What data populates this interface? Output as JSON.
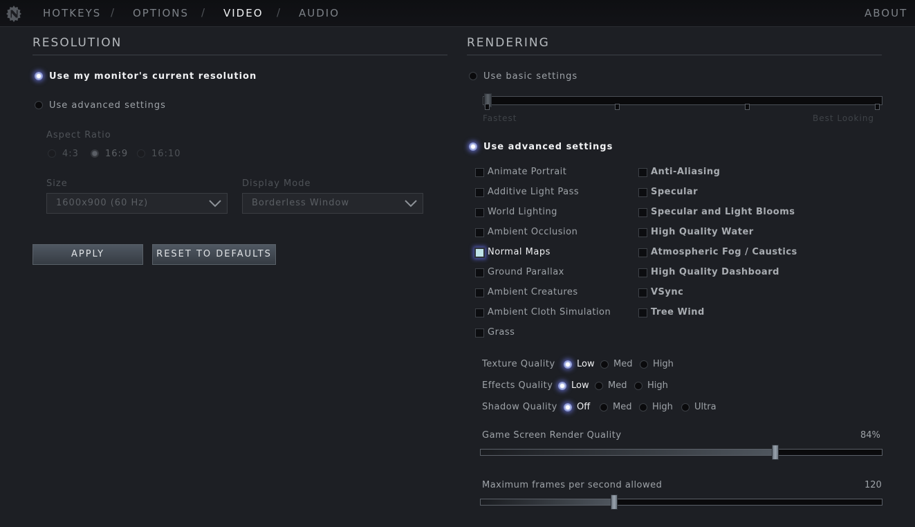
{
  "nav": {
    "hotkeys": "HOTKEYS",
    "options": "OPTIONS",
    "video": "VIDEO",
    "audio": "AUDIO",
    "about": "ABOUT",
    "separator": "/"
  },
  "resolution": {
    "title": "RESOLUTION",
    "use_current": "Use my monitor's current resolution",
    "use_advanced": "Use advanced settings",
    "selected_mode": "Use my monitor's current resolution",
    "aspect_ratio": {
      "label": "Aspect Ratio",
      "options": [
        "4:3",
        "16:9",
        "16:10"
      ],
      "selected": "16:9"
    },
    "size": {
      "label": "Size",
      "value": "1600x900 (60 Hz)"
    },
    "display_mode": {
      "label": "Display Mode",
      "value": "Borderless Window"
    },
    "apply_button": "APPLY",
    "reset_button": "RESET TO DEFAULTS"
  },
  "rendering": {
    "title": "RENDERING",
    "use_basic": "Use basic settings",
    "use_advanced": "Use advanced settings",
    "selected_mode": "Use advanced settings",
    "basic_slider": {
      "min_label": "Fastest",
      "max_label": "Best Looking",
      "stops": 4,
      "value": 0
    },
    "checkboxes_left": [
      {
        "label": "Animate Portrait",
        "checked": false
      },
      {
        "label": "Additive Light Pass",
        "checked": false
      },
      {
        "label": "World Lighting",
        "checked": false
      },
      {
        "label": "Ambient Occlusion",
        "checked": false
      },
      {
        "label": "Normal Maps",
        "checked": true
      },
      {
        "label": "Ground Parallax",
        "checked": false
      },
      {
        "label": "Ambient Creatures",
        "checked": false
      },
      {
        "label": "Ambient Cloth Simulation",
        "checked": false
      },
      {
        "label": "Grass",
        "checked": false
      }
    ],
    "checkboxes_right": [
      {
        "label": "Anti-Aliasing",
        "checked": false
      },
      {
        "label": "Specular",
        "checked": false
      },
      {
        "label": "Specular and Light Blooms",
        "checked": false
      },
      {
        "label": "High Quality Water",
        "checked": false
      },
      {
        "label": "Atmospheric Fog / Caustics",
        "checked": false
      },
      {
        "label": "High Quality Dashboard",
        "checked": false
      },
      {
        "label": "VSync",
        "checked": false
      },
      {
        "label": "Tree Wind",
        "checked": false
      }
    ],
    "texture_quality": {
      "label": "Texture Quality",
      "options": [
        "Low",
        "Med",
        "High"
      ],
      "selected": "Low"
    },
    "effects_quality": {
      "label": "Effects Quality",
      "options": [
        "Low",
        "Med",
        "High"
      ],
      "selected": "Low"
    },
    "shadow_quality": {
      "label": "Shadow Quality",
      "options": [
        "Off",
        "Med",
        "High",
        "Ultra"
      ],
      "selected": "Off"
    },
    "render_quality": {
      "label": "Game Screen Render Quality",
      "value_text": "84%",
      "fraction": 0.735
    },
    "max_fps": {
      "label": "Maximum frames per second allowed",
      "value_text": "120",
      "fraction": 0.333
    }
  },
  "colors": {
    "background": "#1d1f24",
    "accent_glow": "#6f7fc8",
    "text": "#9ea3a8",
    "text_selected": "#f0f1f3"
  },
  "icons": {
    "logo": "dota-gear-icon",
    "dropdown": "chevron-down-icon"
  }
}
